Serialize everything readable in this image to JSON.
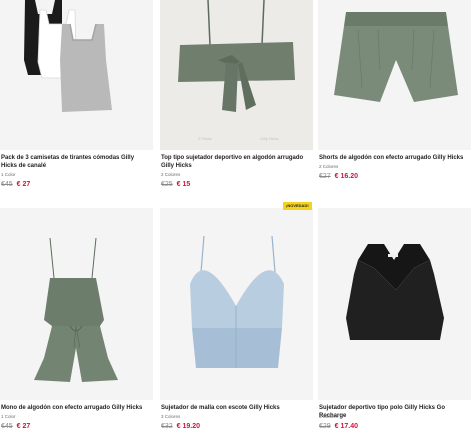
{
  "products": [
    {
      "name": "Pack de 3 camisetas de tirantes cómodas Gilly Hicks de canalé",
      "colors": "1 Color",
      "old_price": "€45",
      "new_price": "€ 27"
    },
    {
      "name": "Top tipo sujetador deportivo en algodón arrugado Gilly Hicks",
      "colors": "2 Colores",
      "old_price": "€25",
      "new_price": "€ 15"
    },
    {
      "name": "Shorts de algodón con efecto arrugado Gilly Hicks",
      "colors": "2 Colores",
      "old_price": "€27",
      "new_price": "€ 16.20"
    },
    {
      "name": "Mono de algodón con efecto arrugado Gilly Hicks",
      "colors": "1 Color",
      "old_price": "€45",
      "new_price": "€ 27"
    },
    {
      "name": "Sujetador de malla con escote Gilly Hicks",
      "colors": "3 Colores",
      "old_price": "€32",
      "new_price": "€ 19.20"
    },
    {
      "name": "Sujetador deportivo tipo polo Gilly Hicks Go Recharge",
      "colors": "3 Colores",
      "old_price": "€29",
      "new_price": "€ 17.40"
    }
  ],
  "badge": "¡NOVEDAD!",
  "icons": [
    "tank-top-pack-image",
    "bandeau-top-image",
    "shorts-image",
    "romper-image",
    "mesh-bra-image",
    "polo-bra-image"
  ],
  "colors": {
    "sale": "#d1123c",
    "badge": "#f5d21b",
    "image_bg": "#f4f4f4"
  }
}
